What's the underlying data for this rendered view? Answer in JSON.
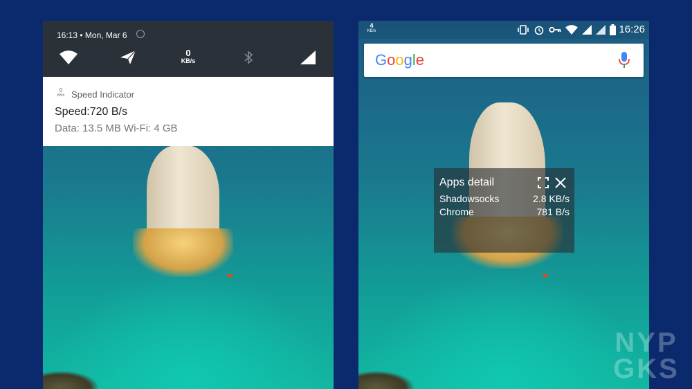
{
  "left_phone": {
    "shade": {
      "time": "16:13",
      "date": "Mon, Mar 6",
      "speed_value": "0",
      "speed_unit": "KB/s"
    },
    "notification": {
      "icon_value": "0",
      "icon_unit": "KB/s",
      "app_name": "Speed Indicator",
      "title": "Speed:720 B/s",
      "body": "Data: 13.5 MB Wi-Fi: 4 GB"
    }
  },
  "right_phone": {
    "statusbar": {
      "speed_value": "4",
      "speed_unit": "KB/s",
      "time": "16:26"
    },
    "search": {
      "logo_letters": [
        "G",
        "o",
        "o",
        "g",
        "l",
        "e"
      ],
      "logo_colors": [
        "#4285F4",
        "#EA4335",
        "#FBBC05",
        "#4285F4",
        "#34A853",
        "#EA4335"
      ]
    },
    "apps_detail": {
      "title": "Apps detail",
      "rows": [
        {
          "app": "Shadowsocks",
          "speed": "2.8 KB/s"
        },
        {
          "app": "Chrome",
          "speed": "781 B/s"
        }
      ]
    }
  },
  "watermark": {
    "line1": "NYP",
    "line2": "GKS"
  },
  "colors": {
    "background": "#0b2a6e",
    "shade": "#2b3139",
    "mic_blue": "#4285F4",
    "mic_red": "#EA4335",
    "boat": "#e24a1e"
  }
}
